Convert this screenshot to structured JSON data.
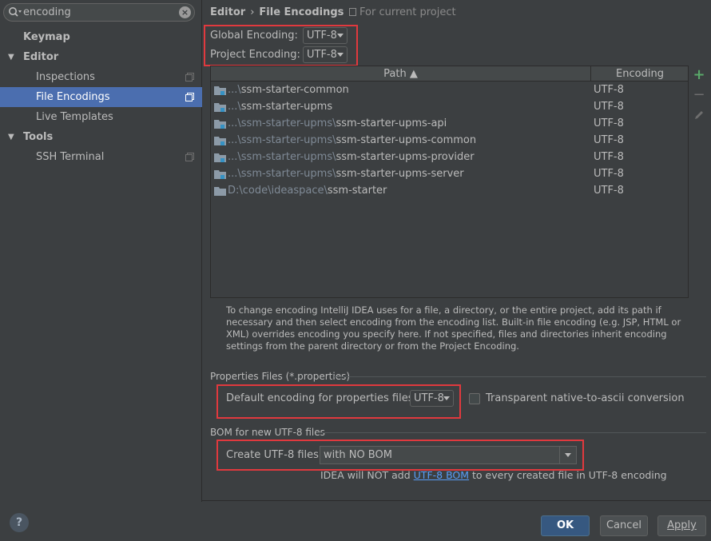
{
  "search": {
    "value": "encoding"
  },
  "sidebar": {
    "items": [
      {
        "label": "Keymap"
      },
      {
        "label": "Editor"
      },
      {
        "label": "Inspections"
      },
      {
        "label": "File Encodings"
      },
      {
        "label": "Live Templates"
      },
      {
        "label": "Tools"
      },
      {
        "label": "SSH Terminal"
      }
    ]
  },
  "header": {
    "crumb_parent": "Editor",
    "crumb_sep": "›",
    "crumb_current": "File Encodings",
    "scope": "For current project"
  },
  "global_encoding": {
    "label": "Global Encoding:",
    "value": "UTF-8"
  },
  "project_encoding": {
    "label": "Project Encoding:",
    "value": "UTF-8"
  },
  "table": {
    "col_path": "Path ▲",
    "col_encoding": "Encoding",
    "rows": [
      {
        "dim": "...\\",
        "path": "ssm-starter-common",
        "encoding": "UTF-8"
      },
      {
        "dim": "...\\",
        "path": "ssm-starter-upms",
        "encoding": "UTF-8"
      },
      {
        "dim": "...\\ssm-starter-upms\\",
        "path": "ssm-starter-upms-api",
        "encoding": "UTF-8"
      },
      {
        "dim": "...\\ssm-starter-upms\\",
        "path": "ssm-starter-upms-common",
        "encoding": "UTF-8"
      },
      {
        "dim": "...\\ssm-starter-upms\\",
        "path": "ssm-starter-upms-provider",
        "encoding": "UTF-8"
      },
      {
        "dim": "...\\ssm-starter-upms\\",
        "path": "ssm-starter-upms-server",
        "encoding": "UTF-8"
      },
      {
        "dim": "D:\\code\\ideaspace\\",
        "path": "ssm-starter",
        "encoding": "UTF-8"
      }
    ]
  },
  "description": "To change encoding IntelliJ IDEA uses for a file, a directory, or the entire project, add its path if necessary and then select encoding from the encoding list. Built-in file encoding (e.g. JSP, HTML or XML) overrides encoding you specify here. If not specified, files and directories inherit encoding settings from the parent directory or from the Project Encoding.",
  "properties": {
    "section_title": "Properties Files (*.properties)",
    "default_label": "Default encoding for properties files:",
    "default_value": "UTF-8",
    "transparent_label": "Transparent native-to-ascii conversion"
  },
  "bom": {
    "section_title": "BOM for new UTF-8 files",
    "create_label": "Create UTF-8 files:",
    "create_value": "with NO BOM",
    "note_before": "IDEA will NOT add ",
    "note_link": "UTF-8 BOM",
    "note_after": " to every created file in UTF-8 encoding"
  },
  "buttons": {
    "ok": "OK",
    "cancel": "Cancel",
    "apply": "Apply"
  },
  "colors": {
    "accent": "#4b6eaf",
    "highlight_border": "#e0393e",
    "link": "#589df6",
    "add_icon": "#59a869"
  }
}
